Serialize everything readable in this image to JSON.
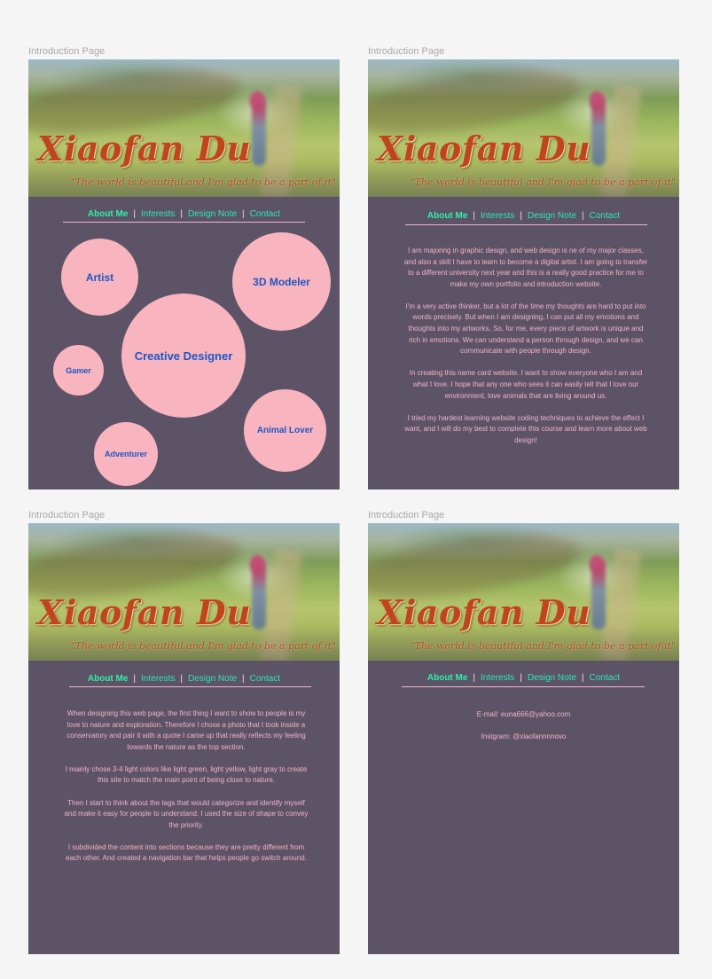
{
  "frame_label": "Introduction Page",
  "hero": {
    "name": "Xiaofan Du",
    "quote": "\"The world is beautiful and I'm glad to be a part of it\""
  },
  "nav": {
    "about": "About Me",
    "interests": "Interests",
    "design_note": "Design Note",
    "contact": "Contact",
    "separator": "|"
  },
  "bubbles": {
    "artist": "Artist",
    "modeler": "3D Modeler",
    "creative": "Creative Designer",
    "gamer": "Gamer",
    "animal": "Animal Lover",
    "adventurer": "Adventurer"
  },
  "about": {
    "paragraphs": [
      "I am majoring in graphic design, and web design is ne of my major classes, and also a skill I have to learn to become a digital artist. I am going to transfer to a different university next year and this is a really good practice for me to make my own portfolio and introduction website.",
      "I'm a very active thinker, but a lot of the time my thoughts are hard to put into words precisely. But when I am designing, I can put all my emotions and thoughts into my artworks. So, for me, every piece of artwork is unique and rich in emotions. We can understand a person through design, and we can communicate with people through design.",
      "In creating this name card website. I want to show everyone who I am and what I love. I hope that any one who sees it can easily tell that I love our environment, love animals that are living around us.",
      "I tried my hardest learning website coding techniques to achieve the effect I want, and I will do my best to complete this course and learn more about web design!"
    ]
  },
  "design_note": {
    "paragraphs": [
      "When designing this web page, the first thing I want to show to people is my love to nature and exploration. Therefore I chose a photo that I took inside a conservatory and pair it with a quote I came up that really reflects my feeling towards the nature as the top section.",
      "I mainly chose 3-4 light colors like light green, light yellow, light gray to create this site to match the main point of being close to nature.",
      "Then I start to think about the tags that would categorize and identify myself and make it easy for people to understand. I used the size of shape to convey the priority.",
      "I subdivided the content into sections because they are pretty different from each other. And created a navigation bar that helps people go switch around."
    ]
  },
  "contact": {
    "email": "E-mail: euna666@yahoo.com",
    "instagram": "Instgram: @xiaofannnnovo"
  },
  "colors": {
    "panel_bg": "#5d5367",
    "bubble": "#f8b4bf",
    "bubble_text": "#1f57c3",
    "nav_active": "#2ef0a8",
    "nav_link": "#2ee6b6",
    "body_text": "#f3b3c3",
    "name_text": "#c0451d"
  }
}
